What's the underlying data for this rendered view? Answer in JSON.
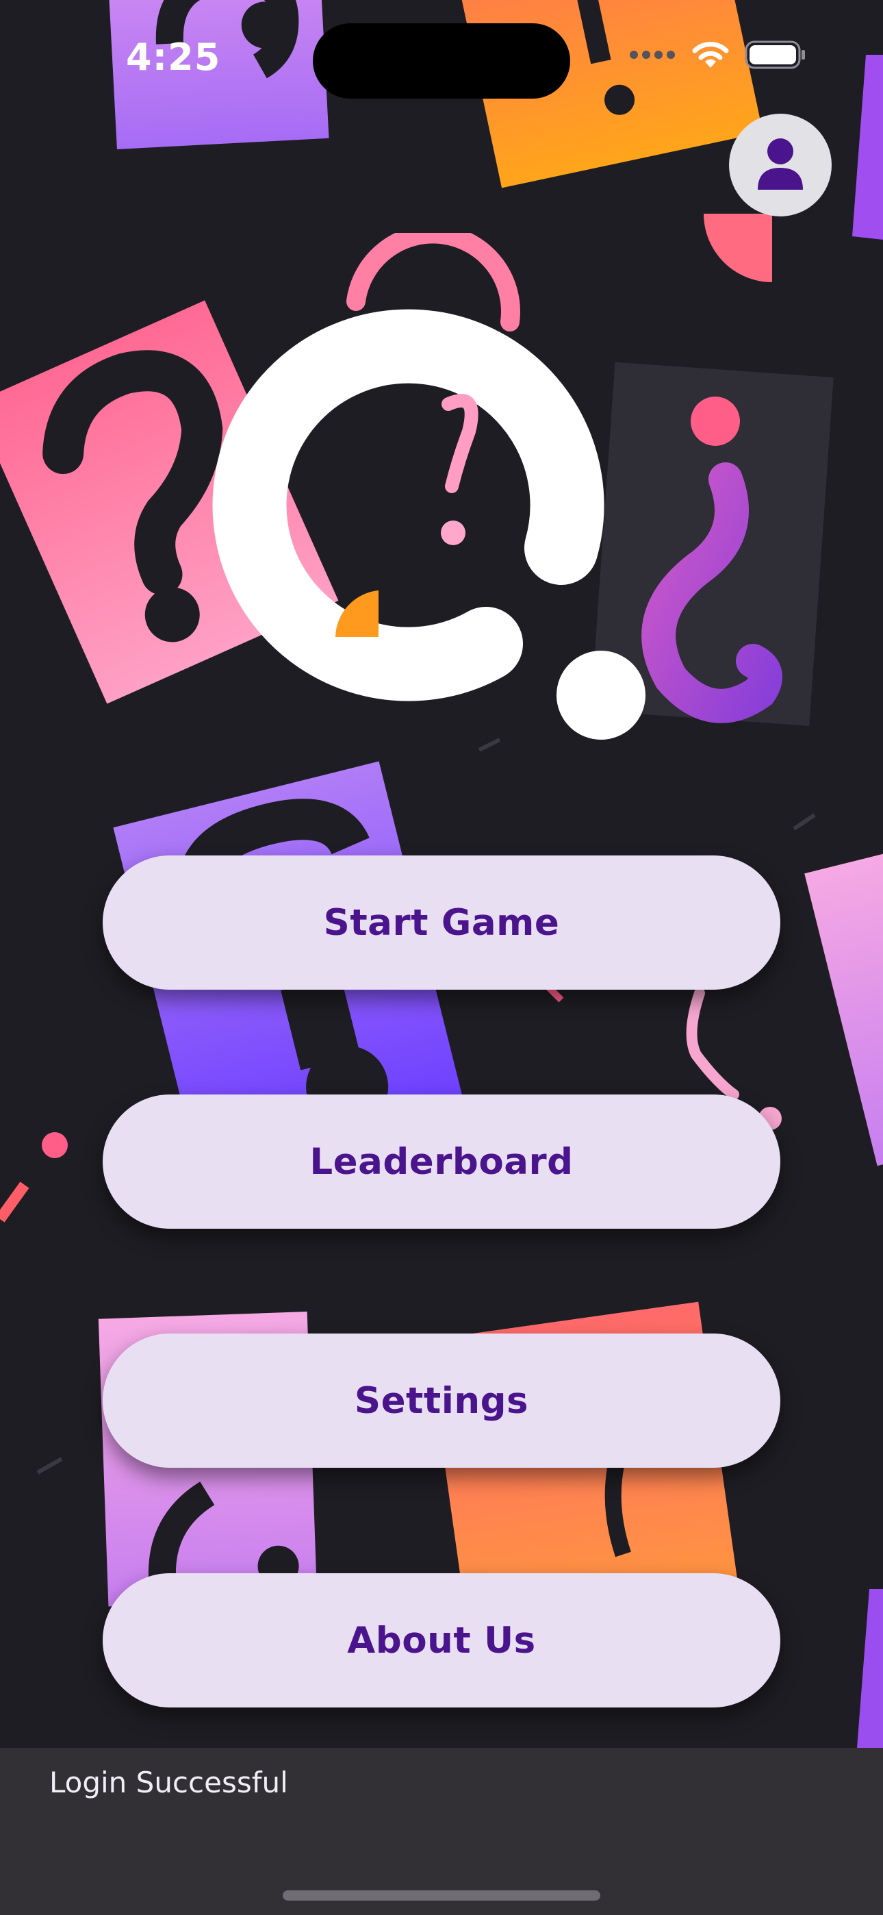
{
  "status_bar": {
    "time": "4:25",
    "signal_icon": "cellular-signal-icon",
    "wifi_icon": "wifi-icon",
    "battery_icon": "battery-icon"
  },
  "profile": {
    "icon": "person-icon"
  },
  "logo": {
    "icon": "quiz-logo-icon"
  },
  "menu": {
    "start_game": "Start Game",
    "leaderboard": "Leaderboard",
    "settings": "Settings",
    "about_us": "About Us"
  },
  "snackbar": {
    "message": "Login Successful"
  },
  "colors": {
    "background": "#1e1d23",
    "button_fill": "#e9dff3",
    "button_text": "#4a148c",
    "accent_pink": "#ff5e88",
    "accent_purple": "#8a4dff",
    "accent_orange": "#ff9a1f"
  }
}
